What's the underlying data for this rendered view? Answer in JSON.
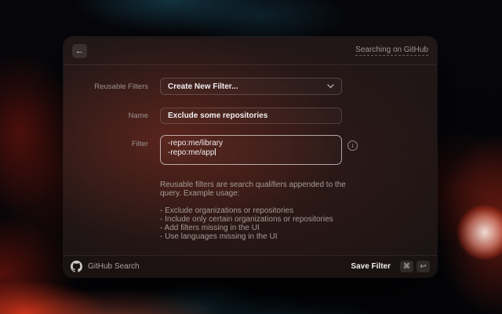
{
  "header": {
    "link": "Searching on GitHub"
  },
  "form": {
    "reusable_filters": {
      "label": "Reusable Filters",
      "value": "Create New Filter..."
    },
    "name": {
      "label": "Name",
      "value": "Exclude some repositories"
    },
    "filter": {
      "label": "Filter",
      "lines": [
        "-repo:me/library",
        "-repo:me/app"
      ]
    },
    "help": {
      "intro": [
        "Reusable filters are search qualifiers appended to the",
        "query. Example usage:"
      ],
      "bullets": [
        "- Exclude organizations or repositories",
        "- Include only certain organizations or repositories",
        "- Add filters missing in the UI",
        "- Use languages missing in the UI"
      ]
    }
  },
  "footer": {
    "app_name": "GitHub Search",
    "action": "Save Filter",
    "keys": [
      "⌘",
      "↩"
    ]
  },
  "icons": {
    "back": "←",
    "info": "i",
    "chevron_down": "chevron-down",
    "github": "github-logo",
    "command": "⌘",
    "return": "↩"
  },
  "colors": {
    "accent_red": "#c03422",
    "teal_streak": "#14455a",
    "panel_base": "#1e1515",
    "focus_border": "#ffffff"
  }
}
